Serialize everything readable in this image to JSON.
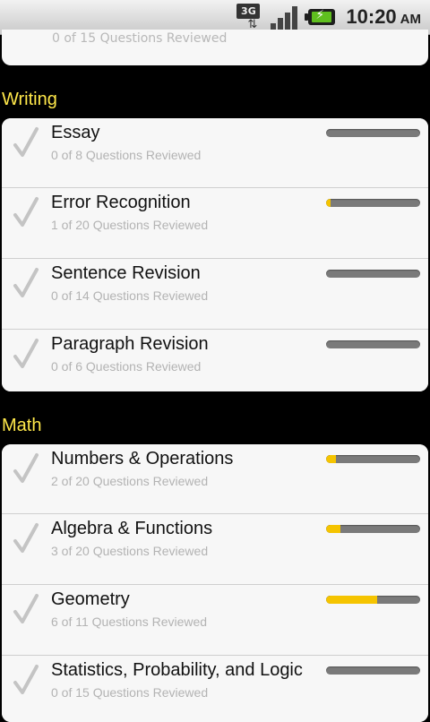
{
  "status_bar": {
    "network": "3G",
    "time": "10:20",
    "ampm": "AM",
    "icons": [
      "3g-data-icon",
      "signal-icon",
      "battery-charging-icon"
    ]
  },
  "partial_card": {
    "subtitle": "0 of 15 Questions Reviewed"
  },
  "sections": [
    {
      "title": "Writing",
      "items": [
        {
          "title": "Essay",
          "subtitle": "0 of 8 Questions Reviewed",
          "reviewed": 0,
          "total": 8
        },
        {
          "title": "Error Recognition",
          "subtitle": "1 of 20 Questions Reviewed",
          "reviewed": 1,
          "total": 20
        },
        {
          "title": "Sentence Revision",
          "subtitle": "0 of 14 Questions Reviewed",
          "reviewed": 0,
          "total": 14
        },
        {
          "title": "Paragraph Revision",
          "subtitle": "0 of 6 Questions Reviewed",
          "reviewed": 0,
          "total": 6
        }
      ]
    },
    {
      "title": "Math",
      "items": [
        {
          "title": "Numbers & Operations",
          "subtitle": "2 of 20 Questions Reviewed",
          "reviewed": 2,
          "total": 20
        },
        {
          "title": "Algebra & Functions",
          "subtitle": "3 of 20 Questions Reviewed",
          "reviewed": 3,
          "total": 20
        },
        {
          "title": "Geometry",
          "subtitle": "6 of 11 Questions Reviewed",
          "reviewed": 6,
          "total": 11
        },
        {
          "title": "Statistics, Probability, and Logic",
          "subtitle": "0 of 15 Questions Reviewed",
          "reviewed": 0,
          "total": 15
        }
      ]
    }
  ],
  "colors": {
    "section_header": "#ffe84a",
    "progress_fill": "#f5c400",
    "progress_track": "#7a7a7a"
  }
}
